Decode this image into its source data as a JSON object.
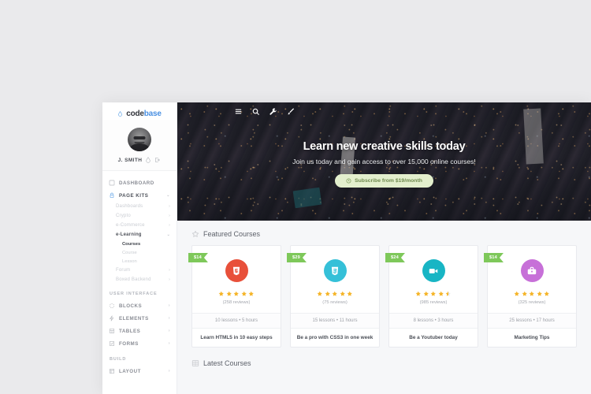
{
  "brand": {
    "code": "code",
    "base": "base"
  },
  "profile": {
    "name": "J. SMITH"
  },
  "sidebar": {
    "groups": [
      {
        "label": "",
        "items": [
          {
            "label": "DASHBOARD",
            "icon": "dashboard-icon",
            "active": false,
            "caret": ""
          },
          {
            "label": "PAGE KITS",
            "icon": "page-kits-icon",
            "active": true,
            "caret": "⌄"
          }
        ]
      }
    ],
    "page_kits_sub": [
      {
        "label": "Dashboards",
        "caret": "›",
        "selected": false
      },
      {
        "label": "Crypto",
        "caret": "›",
        "selected": false
      },
      {
        "label": "e-Commerce",
        "caret": "›",
        "selected": false
      },
      {
        "label": "e-Learning",
        "caret": "⌄",
        "selected": true
      }
    ],
    "elearning_sub": [
      {
        "label": "Courses",
        "selected": true
      },
      {
        "label": "Course",
        "selected": false
      },
      {
        "label": "Lesson",
        "selected": false
      }
    ],
    "page_kits_rest": [
      {
        "label": "Forum",
        "caret": "›"
      },
      {
        "label": "Boxed Backend",
        "caret": "›"
      }
    ],
    "ui_group_label": "USER INTERFACE",
    "ui_items": [
      {
        "label": "BLOCKS",
        "icon": "blocks-icon",
        "caret": "›"
      },
      {
        "label": "ELEMENTS",
        "icon": "elements-icon",
        "caret": "›"
      },
      {
        "label": "TABLES",
        "icon": "tables-icon",
        "caret": "›"
      },
      {
        "label": "FORMS",
        "icon": "forms-icon",
        "caret": "›"
      }
    ],
    "build_group_label": "BUILD",
    "build_items": [
      {
        "label": "LAYOUT",
        "icon": "layout-icon",
        "caret": "›"
      }
    ]
  },
  "hero": {
    "toolbar": [
      "menu-icon",
      "search-icon",
      "wrench-icon",
      "brush-icon"
    ],
    "title": "Learn new creative skills today",
    "subtitle": "Join us today and gain access to over 15,000 online courses!",
    "button_label": "Subscribe from $19/month"
  },
  "content": {
    "featured_title": "Featured Courses",
    "featured_icon": "star-outline-icon",
    "latest_title": "Latest Courses",
    "latest_icon": "book-icon",
    "cards": [
      {
        "price": "$14",
        "icon": "html5-icon",
        "color": "#e8503a",
        "stars": 5,
        "half": false,
        "reviews": "(258 reviews)",
        "meta": "10 lessons • 5 hours",
        "title": "Learn HTML5 in 10 easy steps"
      },
      {
        "price": "$29",
        "icon": "css3-icon",
        "color": "#35c0d8",
        "stars": 5,
        "half": false,
        "reviews": "(75 reviews)",
        "meta": "15 lessons • 11 hours",
        "title": "Be a pro with CSS3 in one week"
      },
      {
        "price": "$24",
        "icon": "video-icon",
        "color": "#18b5c4",
        "stars": 4,
        "half": true,
        "reviews": "(985 reviews)",
        "meta": "8 lessons • 3 hours",
        "title": "Be a Youtuber today"
      },
      {
        "price": "$14",
        "icon": "briefcase-icon",
        "color": "#c770d8",
        "stars": 5,
        "half": false,
        "reviews": "(325 reviews)",
        "meta": "25 lessons • 17 hours",
        "title": "Marketing Tips"
      }
    ]
  },
  "colors": {
    "accent_blue": "#4a90e2",
    "badge_green": "#7ec85a",
    "star_gold": "#f5b428",
    "button_green_bg": "#e3efcd"
  }
}
